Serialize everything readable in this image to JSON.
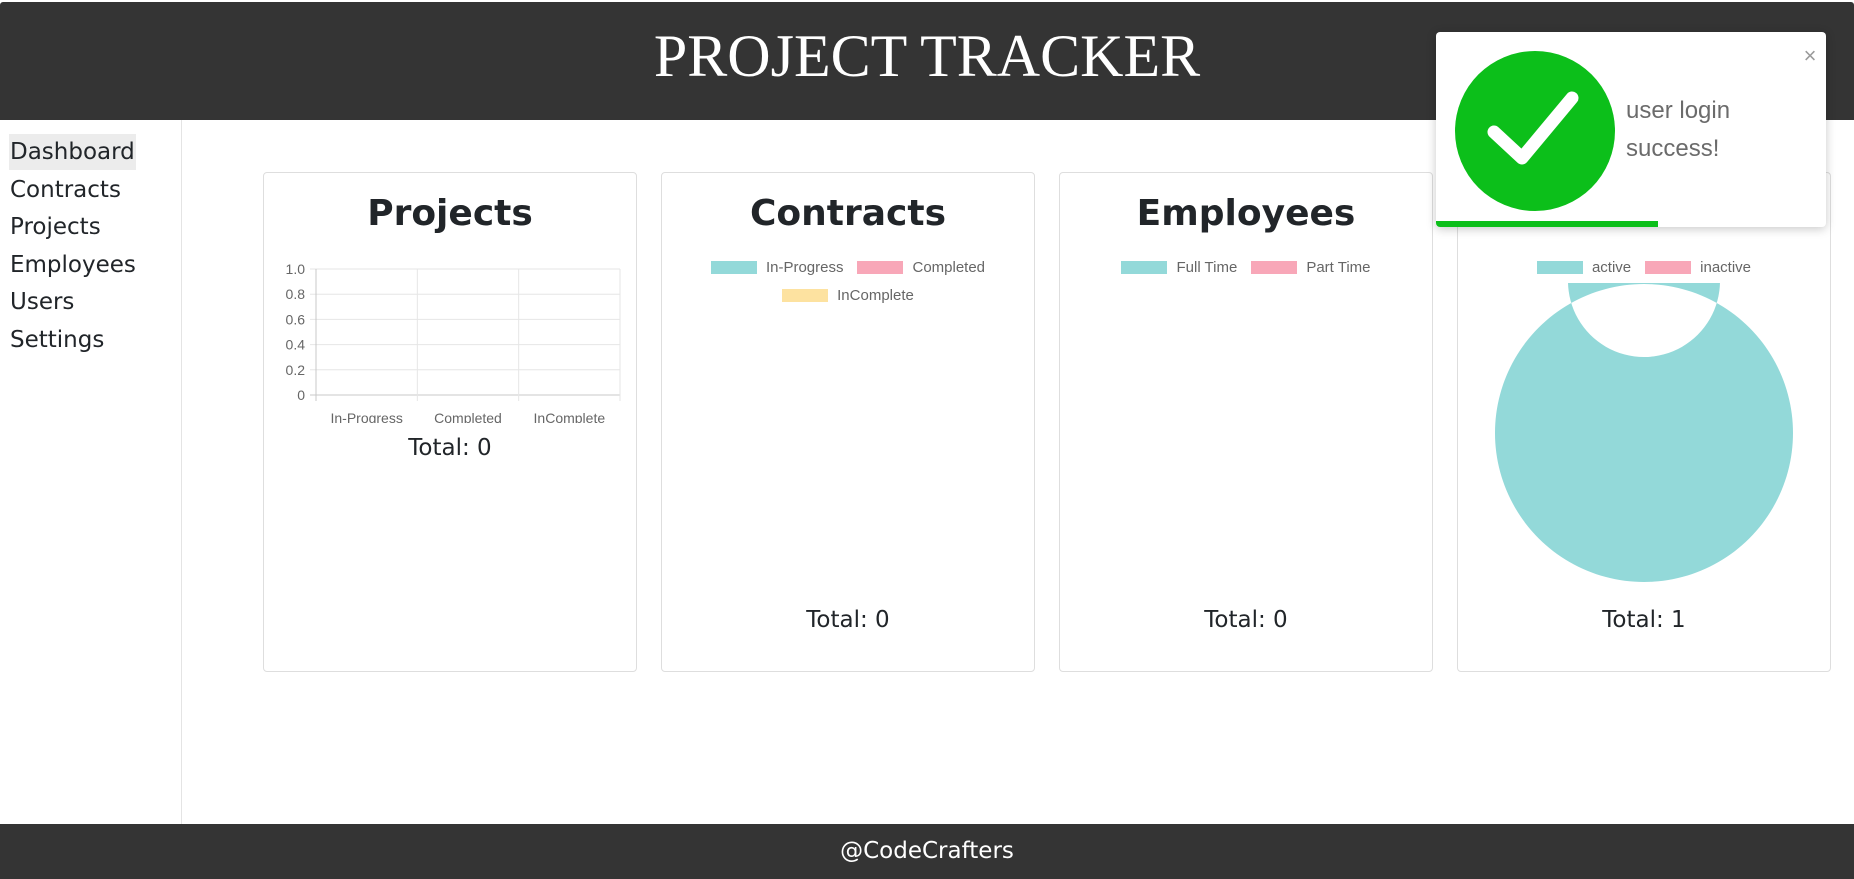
{
  "header": {
    "title": "PROJECT TRACKER"
  },
  "sidebar": {
    "items": [
      {
        "label": "Dashboard",
        "active": true
      },
      {
        "label": "Contracts"
      },
      {
        "label": "Projects"
      },
      {
        "label": "Employees"
      },
      {
        "label": "Users"
      },
      {
        "label": "Settings"
      }
    ]
  },
  "cards": {
    "projects": {
      "title": "Projects",
      "total": "Total: 0"
    },
    "contracts": {
      "title": "Contracts",
      "legend": [
        {
          "label": "In-Progress",
          "color": "#93d9d9"
        },
        {
          "label": "Completed",
          "color": "#f8a7b8"
        },
        {
          "label": "InComplete",
          "color": "#fde2a0"
        }
      ],
      "total": "Total: 0"
    },
    "employees": {
      "title": "Employees",
      "legend": [
        {
          "label": "Full Time",
          "color": "#93d9d9"
        },
        {
          "label": "Part Time",
          "color": "#f8a7b8"
        }
      ],
      "total": "Total: 0"
    },
    "users": {
      "legend": [
        {
          "label": "active",
          "color": "#93d9d9"
        },
        {
          "label": "inactive",
          "color": "#f8a7b8"
        }
      ],
      "total": "Total: 1"
    }
  },
  "chart_data": [
    {
      "type": "bar",
      "categories": [
        "In-Progress",
        "Completed",
        "InComplete"
      ],
      "values": [
        0,
        0,
        0
      ],
      "ylim": [
        0,
        1.0
      ],
      "yticks": [
        "1.0",
        "0.8",
        "0.6",
        "0.4",
        "0.2",
        "0"
      ],
      "grid": true,
      "legend": "none"
    },
    {
      "type": "pie",
      "labels": [
        "active",
        "inactive"
      ],
      "values": [
        1,
        0
      ],
      "colors": [
        "#93d9d9",
        "#f8a7b8"
      ],
      "donut": true
    }
  ],
  "toast": {
    "message": "user login success!",
    "close": "×",
    "progress": 0.57,
    "accent": "#0cbf1a"
  },
  "footer": {
    "text": "@CodeCrafters"
  },
  "colors": {
    "bar": "#343434",
    "teal": "#93d9d9",
    "pink": "#f8a7b8",
    "yellow": "#fde2a0"
  }
}
